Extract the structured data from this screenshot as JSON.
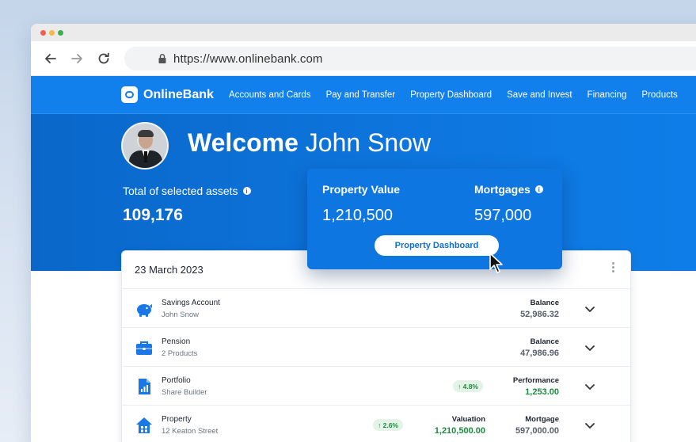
{
  "browser": {
    "url": "https://www.onlinebank.com"
  },
  "site": {
    "logo": "OnlineBank",
    "nav": [
      "Accounts and Cards",
      "Pay and Transfer",
      "Property Dashboard",
      "Save and Invest",
      "Financing",
      "Products"
    ],
    "welcome_prefix": "Welcome",
    "user_name": "John Snow",
    "assets_label": "Total of selected assets",
    "assets_value": "109,176",
    "info_glyph": "i"
  },
  "popup": {
    "property_label": "Property Value",
    "property_value": "1,210,500",
    "mortgages_label": "Mortgages",
    "mortgages_value": "597,000",
    "button": "Property Dashboard"
  },
  "card": {
    "date": "23 March 2023",
    "rows": [
      {
        "icon": "piggy-bank-icon",
        "title": "Savings Account",
        "subtitle": "John Snow",
        "right_label": "Balance",
        "right_value": "52,986.32"
      },
      {
        "icon": "briefcase-icon",
        "title": "Pension",
        "subtitle": "2 Products",
        "right_label": "Balance",
        "right_value": "47,986.96"
      },
      {
        "icon": "document-chart-icon",
        "title": "Portfolio",
        "subtitle": "Share Builder",
        "badge": "↑ 4.8%",
        "right_label": "Performance",
        "right_value": "1,253.00"
      },
      {
        "icon": "house-icon",
        "title": "Property",
        "subtitle": "12 Keaton Street",
        "badge": "↑ 2.6%",
        "mid_label": "Valuation",
        "mid_value": "1,210,500.00",
        "right_label": "Mortgage",
        "right_value": "597,000.00"
      }
    ]
  },
  "colors": {
    "brand_blue": "#1280ec",
    "positive_green": "#1d8a3e"
  }
}
